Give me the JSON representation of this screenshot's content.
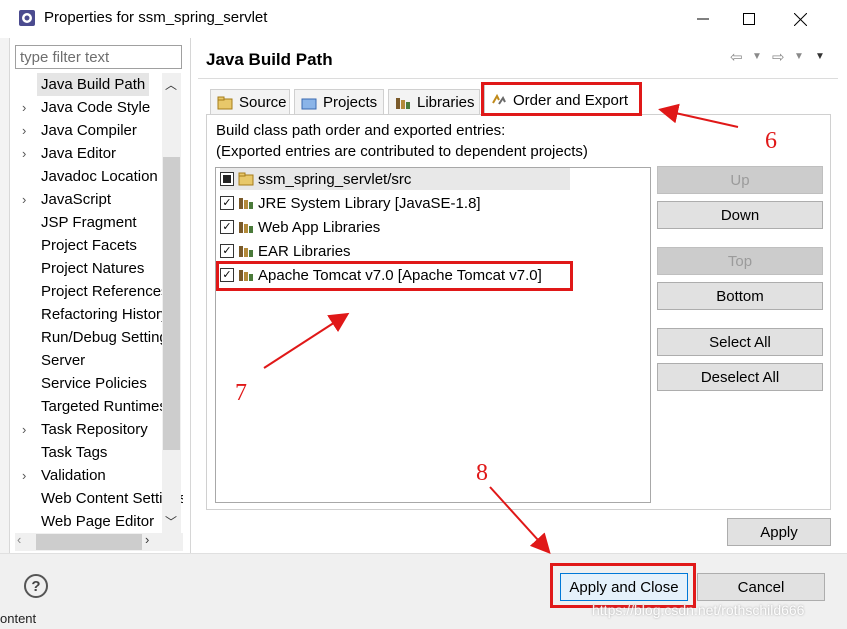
{
  "window": {
    "title": "Properties for ssm_spring_servlet",
    "minimize": "—",
    "maximize": "☐",
    "close": "✕"
  },
  "filter": {
    "placeholder": "type filter text",
    "value": ""
  },
  "tree": {
    "items": [
      {
        "label": "Java Build Path",
        "expandable": false,
        "selected": true
      },
      {
        "label": "Java Code Style",
        "expandable": true
      },
      {
        "label": "Java Compiler",
        "expandable": true
      },
      {
        "label": "Java Editor",
        "expandable": true
      },
      {
        "label": "Javadoc Location",
        "expandable": false
      },
      {
        "label": "JavaScript",
        "expandable": true
      },
      {
        "label": "JSP Fragment",
        "expandable": false
      },
      {
        "label": "Project Facets",
        "expandable": false
      },
      {
        "label": "Project Natures",
        "expandable": false
      },
      {
        "label": "Project References",
        "expandable": false
      },
      {
        "label": "Refactoring History",
        "expandable": false
      },
      {
        "label": "Run/Debug Settings",
        "expandable": false
      },
      {
        "label": "Server",
        "expandable": false
      },
      {
        "label": "Service Policies",
        "expandable": false
      },
      {
        "label": "Targeted Runtimes",
        "expandable": false
      },
      {
        "label": "Task Repository",
        "expandable": true
      },
      {
        "label": "Task Tags",
        "expandable": false
      },
      {
        "label": "Validation",
        "expandable": true
      },
      {
        "label": "Web Content Settings",
        "expandable": false
      },
      {
        "label": "Web Page Editor",
        "expandable": false
      }
    ]
  },
  "page": {
    "title": "Java Build Path",
    "tabs": [
      {
        "label": "Source",
        "active": false
      },
      {
        "label": "Projects",
        "active": false
      },
      {
        "label": "Libraries",
        "active": false
      },
      {
        "label": "Order and Export",
        "active": true
      }
    ],
    "description_line1": "Build class path order and exported entries:",
    "description_line2": "(Exported entries are contributed to dependent projects)",
    "entries": [
      {
        "label": "ssm_spring_servlet/src",
        "checked": "partial",
        "icon": "source-folder-icon"
      },
      {
        "label": "JRE System Library [JavaSE-1.8]",
        "checked": true,
        "icon": "library-icon"
      },
      {
        "label": "Web App Libraries",
        "checked": true,
        "icon": "library-icon"
      },
      {
        "label": "EAR Libraries",
        "checked": true,
        "icon": "library-icon"
      },
      {
        "label": "Apache Tomcat v7.0 [Apache Tomcat v7.0]",
        "checked": true,
        "icon": "library-icon"
      }
    ],
    "buttons": {
      "up": "Up",
      "down": "Down",
      "top": "Top",
      "bottom": "Bottom",
      "select_all": "Select All",
      "deselect_all": "Deselect All"
    },
    "apply": "Apply"
  },
  "footer": {
    "help": "?",
    "apply_and_close": "Apply and Close",
    "cancel": "Cancel"
  },
  "annotations": {
    "six": "6",
    "seven": "7",
    "eight": "8"
  },
  "watermark": "https://blog.csdn.net/rothschild666",
  "peek_text": "ontent",
  "colors": {
    "annotation_red": "#e01818",
    "focus_blue": "#0078d7"
  }
}
